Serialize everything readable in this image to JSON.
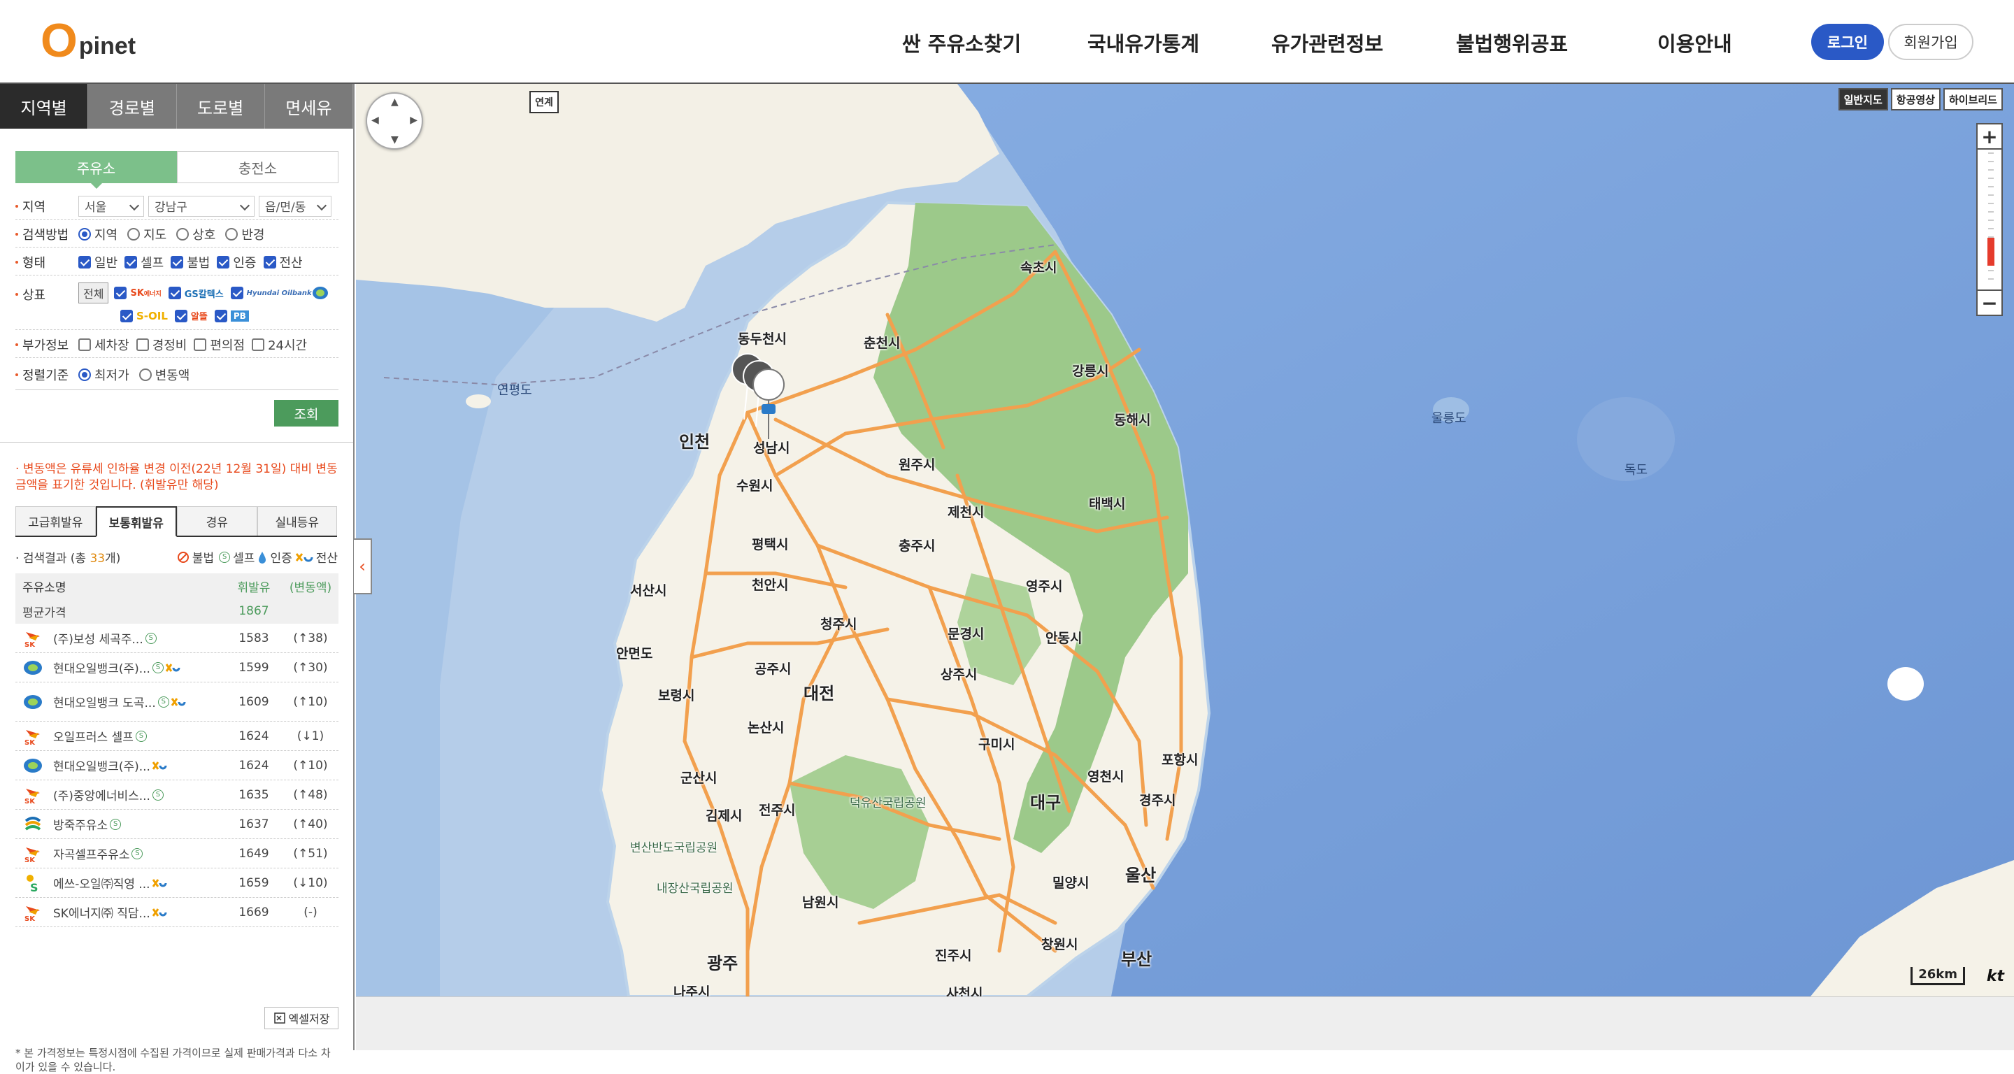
{
  "header": {
    "logo_o": "O",
    "logo_text": "pinet",
    "nav": [
      "싼 주유소찾기",
      "국내유가통계",
      "유가관련정보",
      "불법행위공표",
      "이용안내"
    ],
    "login": "로그인",
    "join": "회원가입"
  },
  "left": {
    "tabs": [
      "지역별",
      "경로별",
      "도로별",
      "면세유"
    ],
    "segments": [
      "주유소",
      "충전소"
    ],
    "filters": {
      "region_label": "지역",
      "region_values": [
        "서울",
        "강남구",
        "읍/면/동"
      ],
      "method_label": "검색방법",
      "method_options": [
        "지역",
        "지도",
        "상호",
        "반경"
      ],
      "type_label": "형태",
      "type_options": [
        "일반",
        "셀프",
        "불법",
        "인증",
        "전산"
      ],
      "brand_label": "상표",
      "brand_all": "전체",
      "brand_names": [
        "SK에너지",
        "GS칼텍스",
        "HD현대오일뱅크",
        "S-OIL",
        "알뜰",
        "PB"
      ],
      "extra_label": "부가정보",
      "extra_options": [
        "세차장",
        "경정비",
        "편의점",
        "24시간"
      ],
      "sort_label": "정렬기준",
      "sort_options": [
        "최저가",
        "변동액"
      ]
    },
    "search_button": "조회",
    "notice": "변동액은 유류세 인하율 변경 이전(22년 12월 31일) 대비 변동 금액을 표기한 것입니다. (휘발유만 해당)",
    "fuel_tabs": [
      "고급휘발유",
      "보통휘발유",
      "경유",
      "실내등유"
    ],
    "result_prefix": "검색결과 (총 ",
    "result_count": "33",
    "result_suffix": "개)",
    "legend": [
      "불법",
      "셀프",
      "인증",
      "전산"
    ],
    "table": {
      "headers": [
        "주유소명",
        "휘발유",
        "(변동액)"
      ],
      "avg_label": "평균가격",
      "avg_value": "1867",
      "rows": [
        {
          "name": "(주)보성 세곡주...",
          "price": "1583",
          "change": "(↑38)"
        },
        {
          "name": "현대오일뱅크(주)...",
          "price": "1599",
          "change": "(↑30)"
        },
        {
          "name": "현대오일뱅크 도곡...",
          "price": "1609",
          "change": "(↑10)"
        },
        {
          "name": "오일프러스 셀프",
          "price": "1624",
          "change": "(↓1)"
        },
        {
          "name": "현대오일뱅크(주)...",
          "price": "1624",
          "change": "(↑10)"
        },
        {
          "name": "(주)중앙에너비스...",
          "price": "1635",
          "change": "(↑48)"
        },
        {
          "name": "방죽주유소",
          "price": "1637",
          "change": "(↑40)"
        },
        {
          "name": "자곡셀프주유소",
          "price": "1649",
          "change": "(↑51)"
        },
        {
          "name": "에쓰-오일㈜직영 ...",
          "price": "1659",
          "change": "(↓10)"
        },
        {
          "name": "SK에너지㈜ 직담...",
          "price": "1669",
          "change": "(-)"
        }
      ]
    },
    "excel_button": "엑셀저장",
    "footnote": "본 가격정보는 특정시점에 수집된 가격이므로 실제 판매가격과 다소 차이가 있을 수 있습니다."
  },
  "map": {
    "roadview": "연계",
    "map_types": [
      "일반지도",
      "항공영상",
      "하이브리드"
    ],
    "scale": "26km",
    "provider": "kt",
    "labels": [
      "속초시",
      "춘천시",
      "동두천시",
      "강릉시",
      "동해시",
      "인천",
      "성남시",
      "수원시",
      "원주시",
      "태백시",
      "제천시",
      "충주시",
      "평택시",
      "천안시",
      "서산시",
      "청주시",
      "영주시",
      "안동시",
      "문경시",
      "상주시",
      "공주시",
      "대전",
      "보령시",
      "안면도",
      "논산시",
      "구미시",
      "포항시",
      "영천시",
      "경주시",
      "군산시",
      "김제시",
      "전주시",
      "대구",
      "밀양시",
      "울산",
      "남원시",
      "창원시",
      "부산",
      "진주시",
      "광주",
      "나주시",
      "사천시",
      "연평도",
      "울릉도",
      "독도",
      "덕유산국립공원",
      "변산반도국립공원",
      "내장산국립공원"
    ]
  }
}
